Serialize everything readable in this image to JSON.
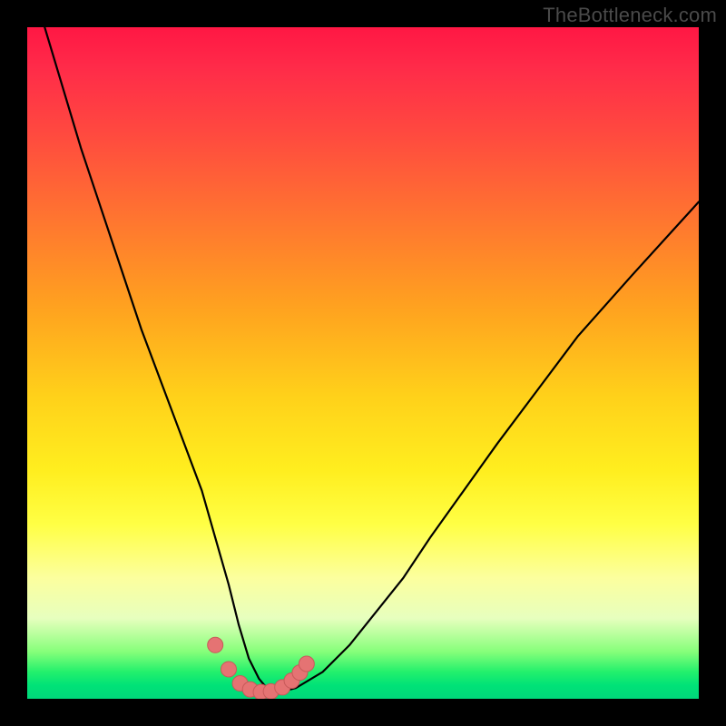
{
  "watermark": {
    "text": "TheBottleneck.com"
  },
  "colors": {
    "frame": "#000000",
    "curve_stroke": "#000000",
    "marker_fill": "#e57373",
    "marker_stroke": "#c85a5a",
    "gradient_stops": [
      "#ff1744",
      "#ff7a2e",
      "#ffd11a",
      "#fcff9e",
      "#23f06c",
      "#00d77a"
    ]
  },
  "chart_data": {
    "type": "line",
    "title": "",
    "xlabel": "",
    "ylabel": "",
    "xlim": [
      0,
      100
    ],
    "ylim": [
      0,
      100
    ],
    "grid": false,
    "legend": false,
    "annotations": [],
    "series": [
      {
        "name": "bottleneck-curve",
        "x": [
          2,
          5,
          8,
          11,
          14,
          17,
          20,
          23,
          26,
          28,
          30,
          31.5,
          33,
          34.5,
          36,
          38,
          40,
          44,
          48,
          52,
          56,
          60,
          65,
          70,
          76,
          82,
          90,
          100
        ],
        "values": [
          102,
          92,
          82,
          73,
          64,
          55,
          47,
          39,
          31,
          24,
          17,
          11,
          6,
          3,
          1.2,
          1.1,
          1.6,
          4,
          8,
          13,
          18,
          24,
          31,
          38,
          46,
          54,
          63,
          74
        ]
      }
    ],
    "markers": {
      "name": "highlight-points",
      "x": [
        28.0,
        30.0,
        31.7,
        33.2,
        34.8,
        36.3,
        38.0,
        39.4,
        40.6,
        41.6
      ],
      "values": [
        8.0,
        4.4,
        2.3,
        1.4,
        1.0,
        1.1,
        1.7,
        2.7,
        3.9,
        5.2
      ]
    }
  }
}
